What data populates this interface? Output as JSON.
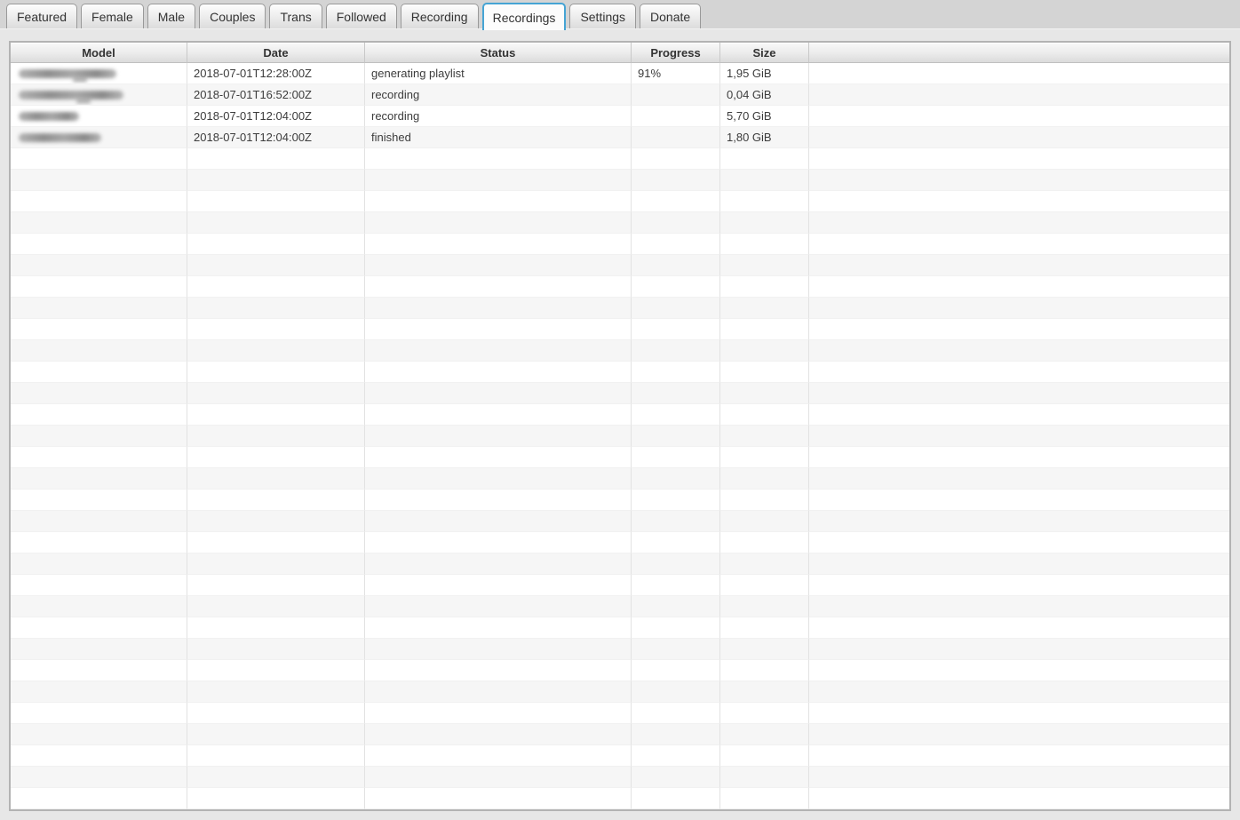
{
  "tabs": [
    {
      "label": "Featured",
      "active": false
    },
    {
      "label": "Female",
      "active": false
    },
    {
      "label": "Male",
      "active": false
    },
    {
      "label": "Couples",
      "active": false
    },
    {
      "label": "Trans",
      "active": false
    },
    {
      "label": "Followed",
      "active": false
    },
    {
      "label": "Recording",
      "active": false
    },
    {
      "label": "Recordings",
      "active": true
    },
    {
      "label": "Settings",
      "active": false
    },
    {
      "label": "Donate",
      "active": false
    }
  ],
  "table": {
    "columns": [
      "Model",
      "Date",
      "Status",
      "Progress",
      "Size",
      ""
    ],
    "rows": [
      {
        "model_redacted": true,
        "redacted_width": 110,
        "date": "2018-07-01T12:28:00Z",
        "status": "generating playlist",
        "progress": "91%",
        "size": "1,95 GiB"
      },
      {
        "model_redacted": true,
        "redacted_width": 118,
        "date": "2018-07-01T16:52:00Z",
        "status": "recording",
        "progress": "",
        "size": "0,04 GiB"
      },
      {
        "model_redacted": true,
        "redacted_width": 68,
        "date": "2018-07-01T12:04:00Z",
        "status": "recording",
        "progress": "",
        "size": "5,70 GiB"
      },
      {
        "model_redacted": true,
        "redacted_width": 93,
        "date": "2018-07-01T12:04:00Z",
        "status": "finished",
        "progress": "",
        "size": "1,80 GiB"
      }
    ],
    "empty_row_count": 31
  },
  "colors": {
    "active_tab_border": "#46a4d4",
    "tabbar_background": "#d4d4d4",
    "page_background": "#e7e7e7",
    "table_border": "#b3b3b3",
    "alt_row_background": "#f6f6f6"
  }
}
